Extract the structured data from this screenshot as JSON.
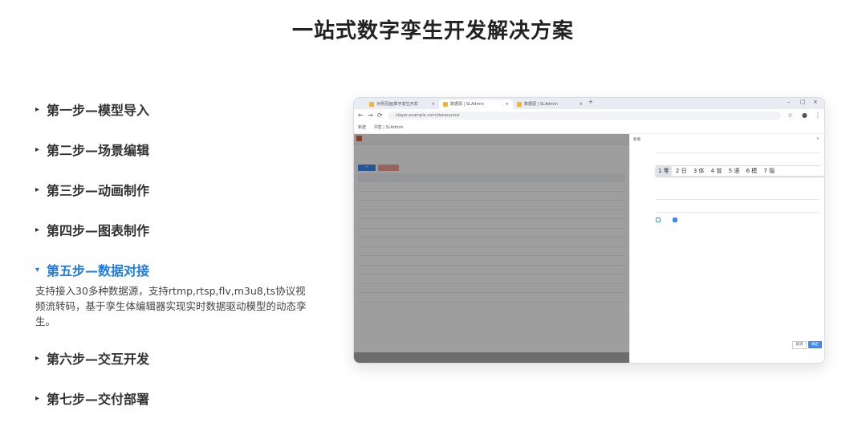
{
  "page": {
    "title": "一站式数字孪生开发解决方案"
  },
  "steps": [
    {
      "label": "第一步—模型导入"
    },
    {
      "label": "第二步—场景编辑"
    },
    {
      "label": "第三步—动画制作"
    },
    {
      "label": "第四步—图表制作"
    },
    {
      "label": "第五步—数据对接",
      "active": true
    },
    {
      "label": "第六步—交互开发"
    },
    {
      "label": "第七步—交付部署"
    }
  ],
  "active_step_description": "支持接入30多种数据源，支持rtmp,rtsp,flv,m3u8,ts协议视频流转码，基于孪生体编辑器实现实时数据驱动模型的动态孪生。",
  "icons": {
    "collapsed": "▸",
    "expanded": "▾"
  },
  "colors": {
    "accent": "#1e7be6",
    "primary_button": "#3d8bf2"
  },
  "browser": {
    "tabs": [
      {
        "label": "示例页面|数字孪生开发"
      },
      {
        "label": "数据源 | SLAdmin",
        "active": true
      },
      {
        "label": "数据源 | SLAdmin"
      }
    ],
    "url": "slayer.example.com/datasource",
    "bookmarks": [
      "新建",
      "书签 | SLAdmin"
    ],
    "ime_candidates": [
      {
        "label": "1 零",
        "selected": true
      },
      {
        "label": "2 日"
      },
      {
        "label": "3 体"
      },
      {
        "label": "4 曾"
      },
      {
        "label": "5 语"
      },
      {
        "label": "6 模"
      },
      {
        "label": "7 隐"
      }
    ],
    "drawer": {
      "title": "新增",
      "close": "×",
      "cancel": "取消",
      "ok": "确定"
    }
  }
}
